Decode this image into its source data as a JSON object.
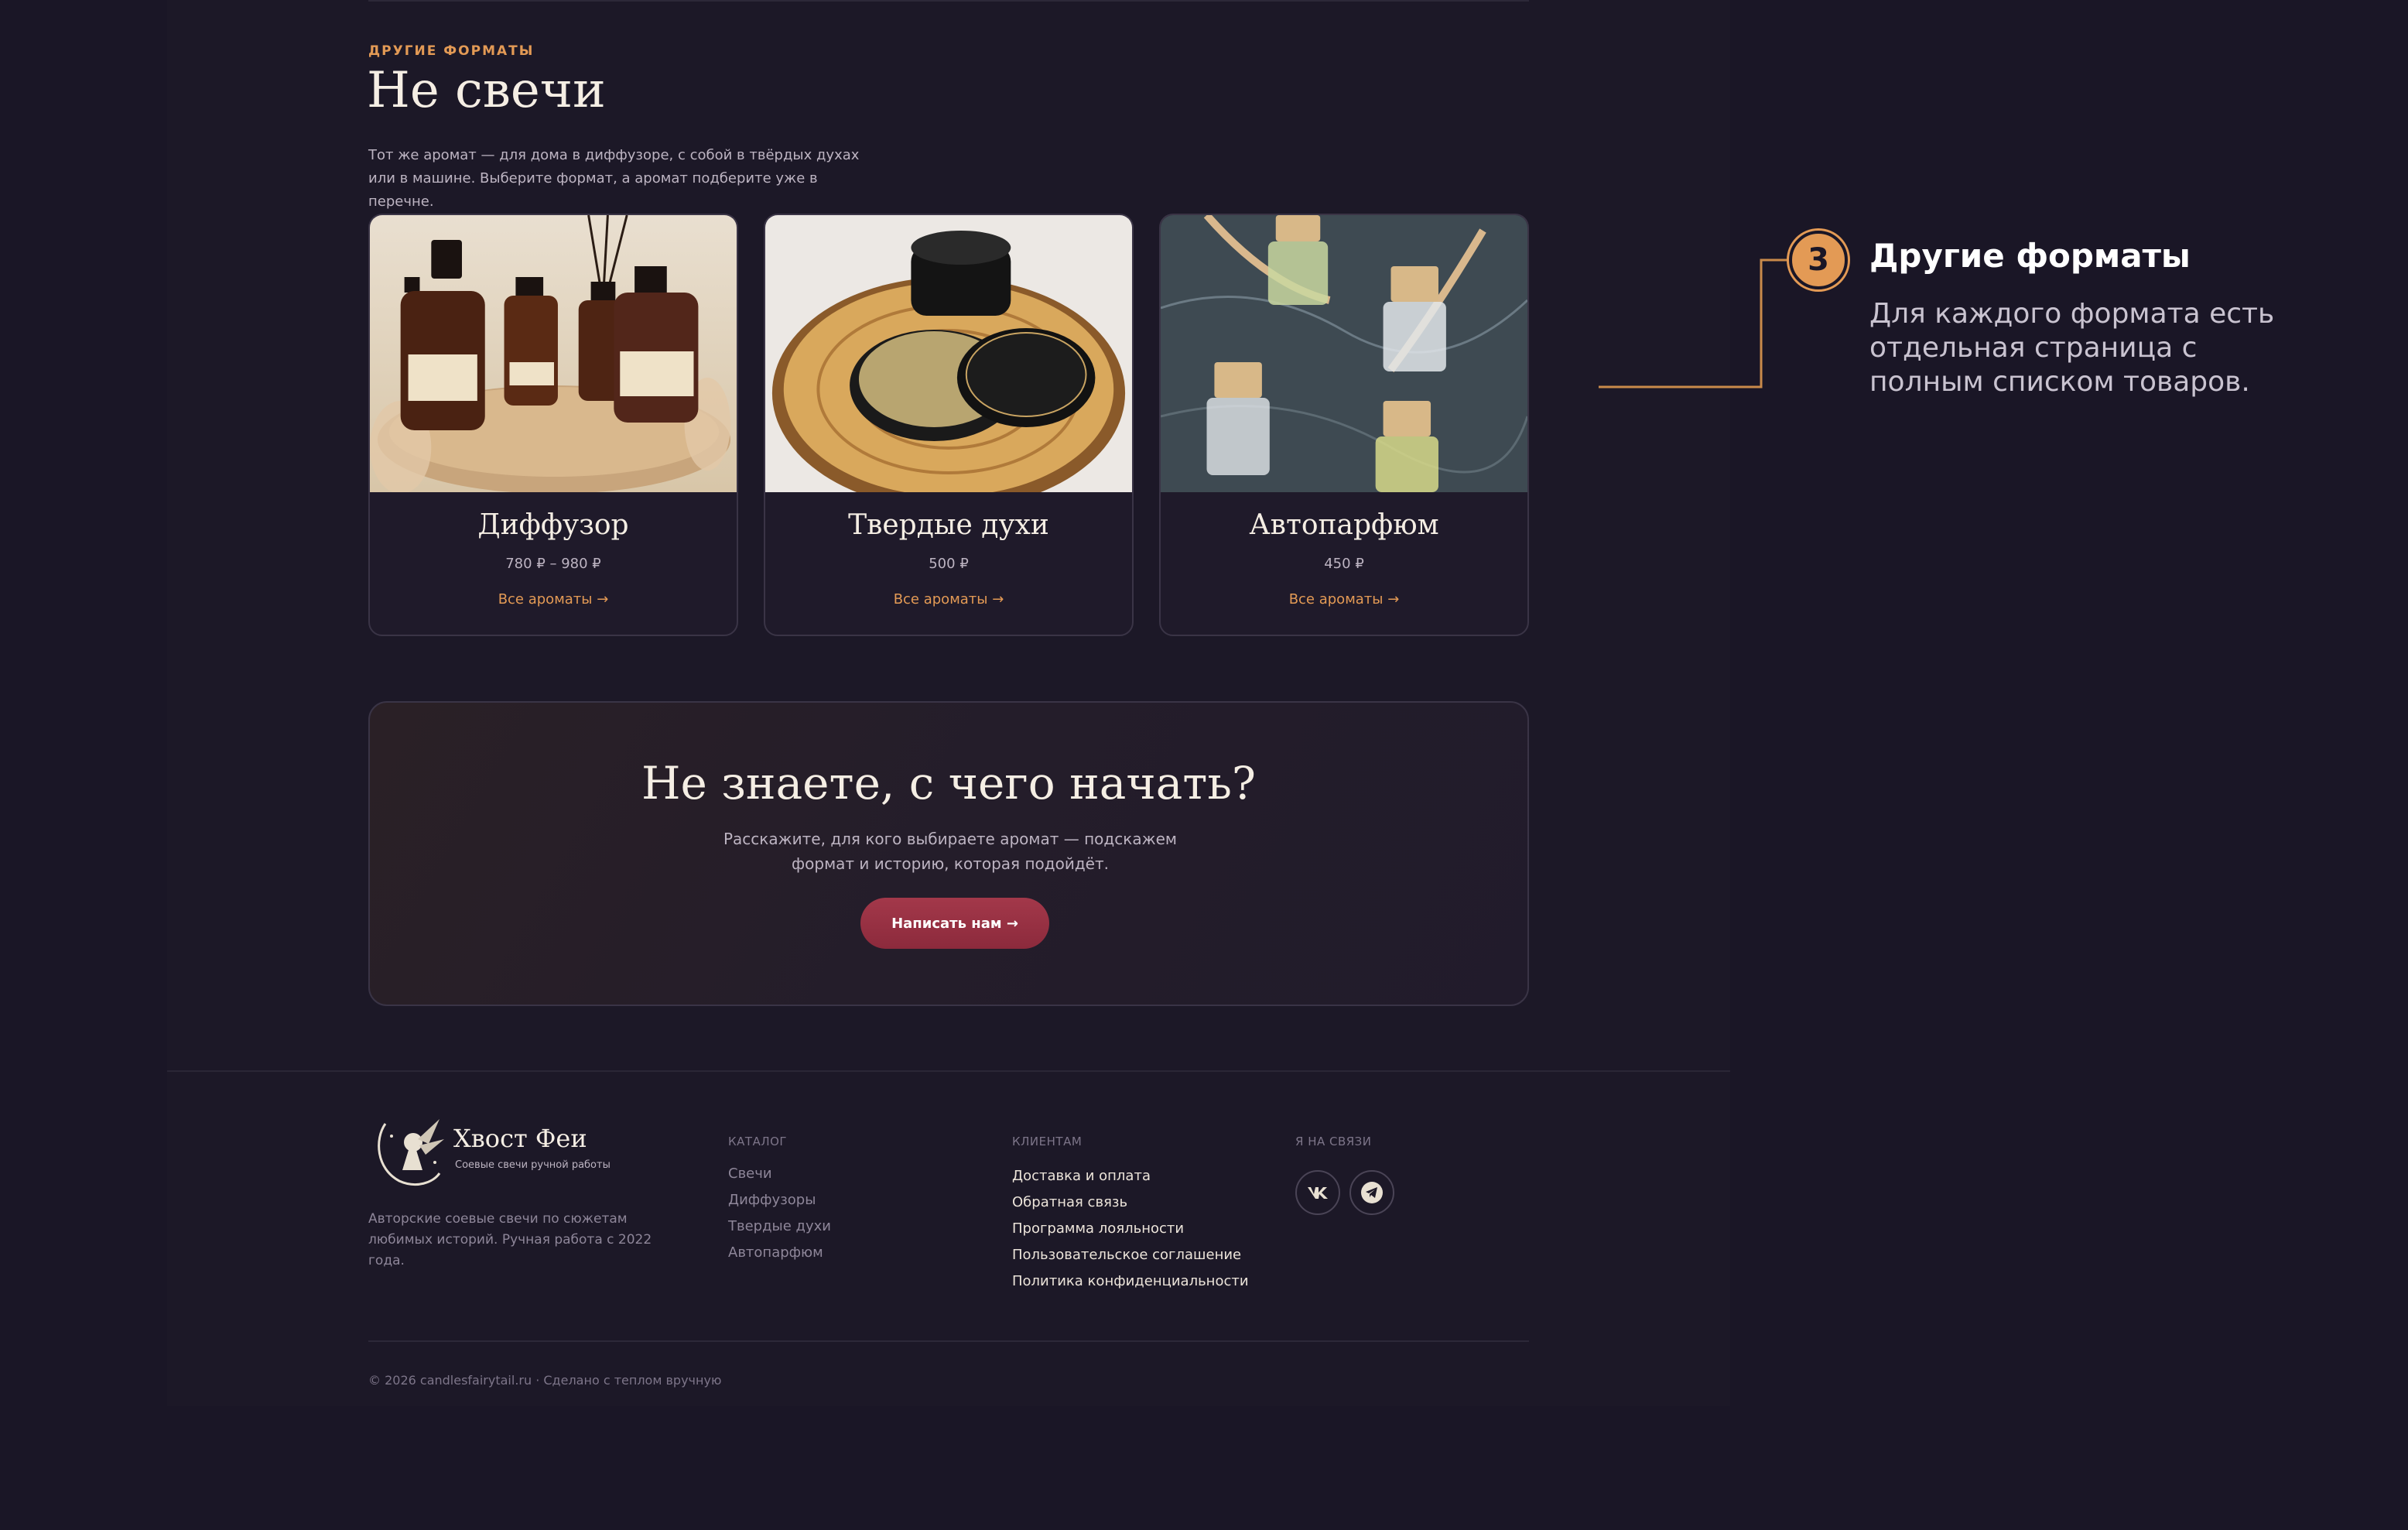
{
  "section": {
    "eyebrow": "ДРУГИЕ ФОРМАТЫ",
    "title": "Не свечи",
    "lead": "Тот же аромат — для дома в диффузоре, с собой в твёрдых духах или в машине. Выберите формат, а аромат подберите уже в перечне."
  },
  "cards": [
    {
      "title": "Диффузор",
      "price": "780 ₽ – 980 ₽",
      "link": "Все ароматы →",
      "image": "diffuser-bottles-photo"
    },
    {
      "title": "Твердые духи",
      "price": "500 ₽",
      "link": "Все ароматы →",
      "image": "solid-perfume-tin-photo"
    },
    {
      "title": "Автопарфюм",
      "price": "450 ₽",
      "link": "Все ароматы →",
      "image": "car-perfume-bottles-photo"
    }
  ],
  "cta": {
    "title": "Не знаете, с чего начать?",
    "text": "Расскажите, для кого выбираете аромат — подскажем формат и историю, которая подойдёт.",
    "button": "Написать нам →"
  },
  "footer": {
    "brand_name": "Хвост Феи",
    "brand_tagline": "Соевые свечи ручной работы",
    "brand_description": "Авторские соевые свечи по сюжетам любимых историй. Ручная работа с 2022 года.",
    "catalog": {
      "heading": "КАТАЛОГ",
      "items": [
        "Свечи",
        "Диффузоры",
        "Твердые духи",
        "Автопарфюм"
      ]
    },
    "clients": {
      "heading": "КЛИЕНТАМ",
      "items": [
        "Доставка и оплата",
        "Обратная связь",
        "Программа лояльности",
        "Пользовательское соглашение",
        "Политика конфиденциальности"
      ]
    },
    "contact": {
      "heading": "Я НА СВЯЗИ",
      "icons": [
        "vk-icon",
        "telegram-icon"
      ]
    },
    "copyright": "© 2026 candlesfairytail.ru · Сделано с теплом вручную"
  },
  "annotation": {
    "number": "3",
    "title": "Другие форматы",
    "text": "Для каждого формата есть отдельная страница с полным списком товаров."
  },
  "colors": {
    "background": "#1a1626",
    "accent": "#e39a55",
    "button": "#9a3243"
  }
}
